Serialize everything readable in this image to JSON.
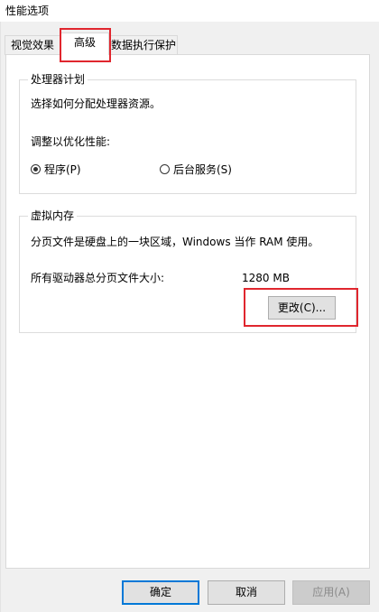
{
  "window": {
    "title": "性能选项"
  },
  "tabs": [
    {
      "label": "视觉效果",
      "active": false
    },
    {
      "label": "高级",
      "active": true
    },
    {
      "label": "数据执行保护",
      "active": false
    }
  ],
  "processor": {
    "legend": "处理器计划",
    "description": "选择如何分配处理器资源。",
    "adjust_label": "调整以优化性能:",
    "options": [
      {
        "label": "程序(P)",
        "checked": true
      },
      {
        "label": "后台服务(S)",
        "checked": false
      }
    ]
  },
  "virtual_memory": {
    "legend": "虚拟内存",
    "description": "分页文件是硬盘上的一块区域，Windows 当作 RAM 使用。",
    "total_label": "所有驱动器总分页文件大小:",
    "total_value": "1280 MB",
    "change_button": "更改(C)..."
  },
  "footer": {
    "ok": "确定",
    "cancel": "取消",
    "apply": "应用(A)"
  },
  "colors": {
    "highlight": "#e0262e",
    "focus_border": "#0078d7"
  }
}
